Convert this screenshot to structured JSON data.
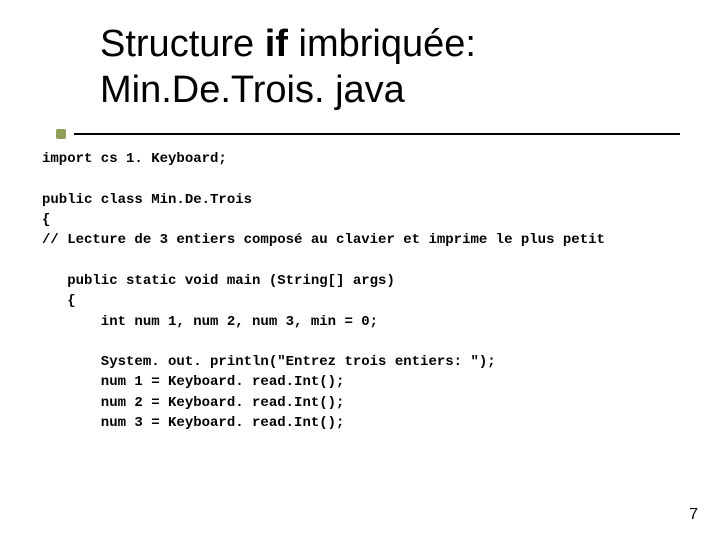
{
  "title": {
    "line1_pre": "Structure ",
    "line1_bold": "if",
    "line1_post": " imbriquée:",
    "line2": "Min.De.Trois. java"
  },
  "code": "import cs 1. Keyboard;\n\npublic class Min.De.Trois\n{\n// Lecture de 3 entiers composé au clavier et imprime le plus petit\n\n   public static void main (String[] args)\n   {\n       int num 1, num 2, num 3, min = 0;\n\n       System. out. println(\"Entrez trois entiers: \");\n       num 1 = Keyboard. read.Int();\n       num 2 = Keyboard. read.Int();\n       num 3 = Keyboard. read.Int();",
  "page_number": "7"
}
